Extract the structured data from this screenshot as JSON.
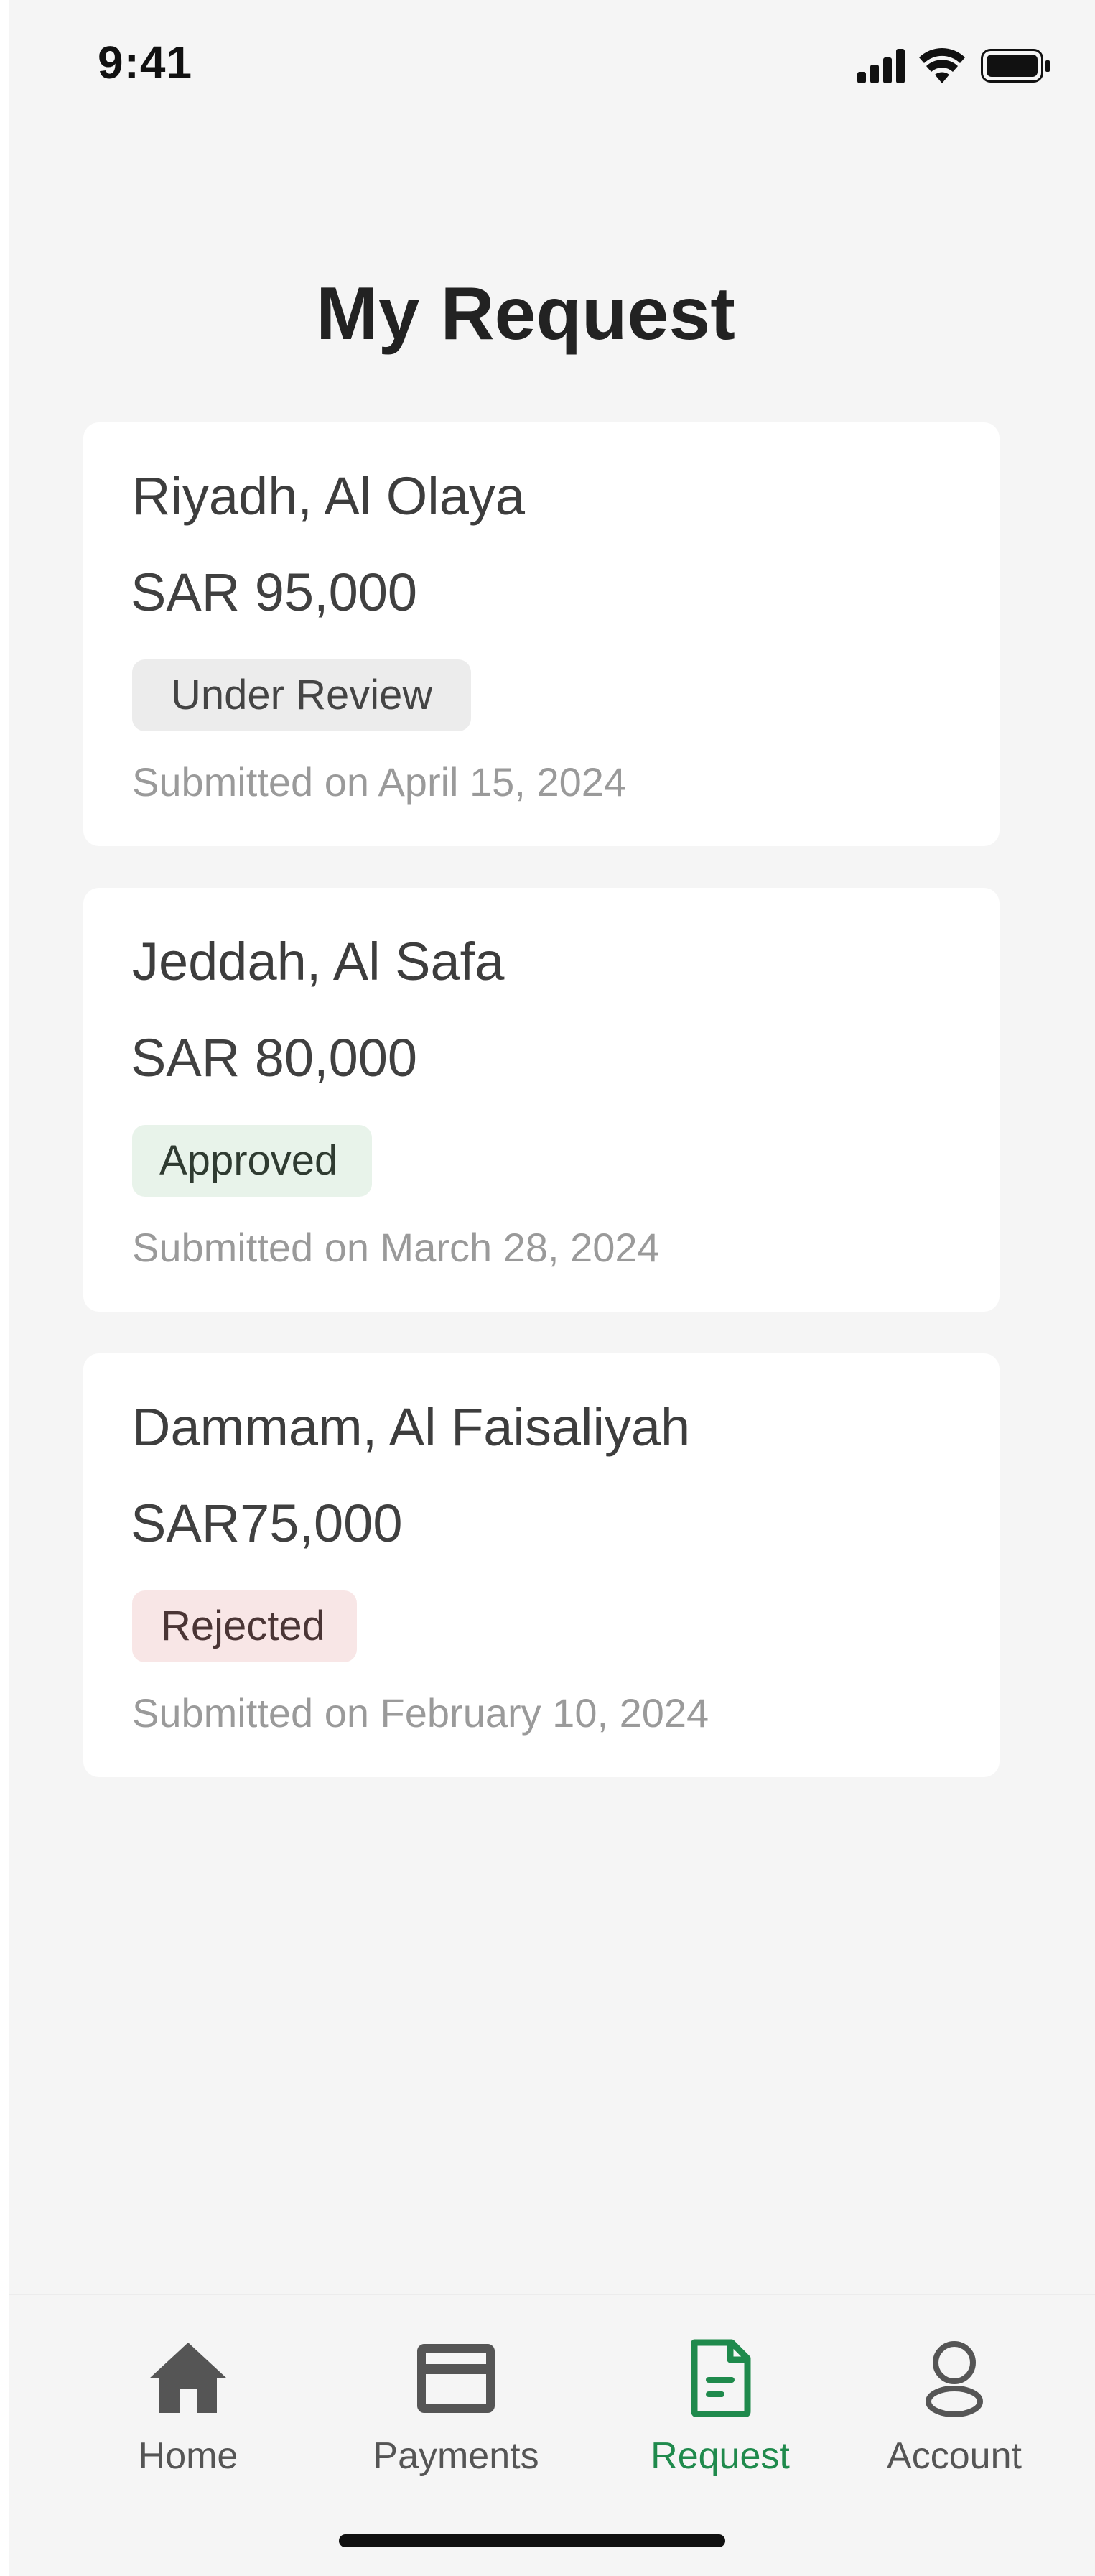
{
  "status_bar": {
    "time": "9:41"
  },
  "header": {
    "title": "My Request"
  },
  "requests": [
    {
      "location": "Riyadh, Al Olaya",
      "amount": "SAR 95,000",
      "status": "Under Review",
      "submitted": "Submitted on April 15, 2024"
    },
    {
      "location": "Jeddah, Al Safa",
      "amount": "SAR 80,000",
      "status": "Approved",
      "submitted": "Submitted on March 28, 2024"
    },
    {
      "location": "Dammam, Al Faisaliyah",
      "amount": "SAR75,000",
      "status": "Rejected",
      "submitted": "Submitted on February 10, 2024"
    }
  ],
  "status_colors": {
    "under_review": "#ececec",
    "approved": "#e8f3ea",
    "rejected": "#f8e6e6"
  },
  "nav": {
    "items": [
      {
        "label": "Home",
        "icon": "home-icon"
      },
      {
        "label": "Payments",
        "icon": "card-icon"
      },
      {
        "label": "Request",
        "icon": "document-icon",
        "active": true
      },
      {
        "label": "Account",
        "icon": "user-icon"
      }
    ],
    "active_color": "#1f8a4c"
  }
}
